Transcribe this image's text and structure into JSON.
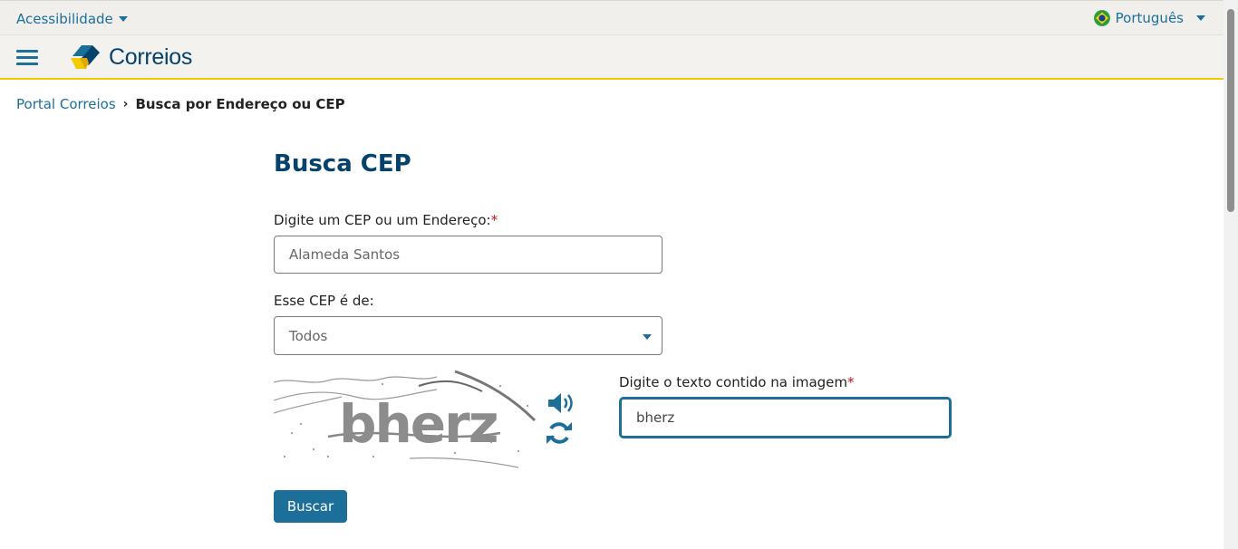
{
  "topbar": {
    "accessibility_label": "Acessibilidade",
    "language_label": "Português"
  },
  "header": {
    "logo_text": "Correios"
  },
  "breadcrumb": {
    "home": "Portal Correios",
    "separator": "›",
    "current": "Busca por Endereço ou CEP"
  },
  "main": {
    "title": "Busca CEP",
    "cep_field": {
      "label": "Digite um CEP ou um Endereço:",
      "required": "*",
      "value": "Alameda Santos"
    },
    "type_field": {
      "label": "Esse CEP é de:",
      "value": "Todos"
    },
    "captcha": {
      "image_text": "bherz",
      "input_label": "Digite o texto contido na imagem",
      "required": "*",
      "value": "bherz"
    },
    "search_button": "Buscar"
  },
  "icons": [
    "caret-down-icon",
    "brazil-flag-icon",
    "hamburger-menu-icon",
    "correios-logo-icon",
    "speaker-icon",
    "refresh-icon"
  ],
  "colors": {
    "brand_blue": "#1b6f99",
    "title_blue": "#05426c",
    "accent_yellow": "#f3c900",
    "required_red": "#c0131a"
  }
}
